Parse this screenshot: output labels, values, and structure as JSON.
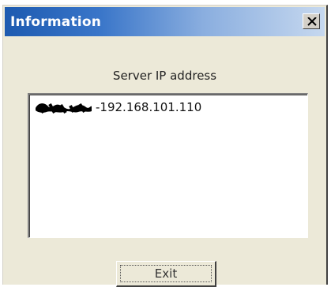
{
  "window": {
    "title": "Information",
    "close_symbol": "×",
    "title_gradient": [
      "#1d5ab0",
      "#c6d8ef"
    ]
  },
  "dialog": {
    "label": "Server IP address",
    "list": {
      "items": [
        {
          "name_redacted": true,
          "separator": "- ",
          "ip": "192.168.101.110"
        }
      ]
    },
    "exit_button": {
      "label": "Exit"
    }
  },
  "icons": {
    "close": "close-icon"
  }
}
